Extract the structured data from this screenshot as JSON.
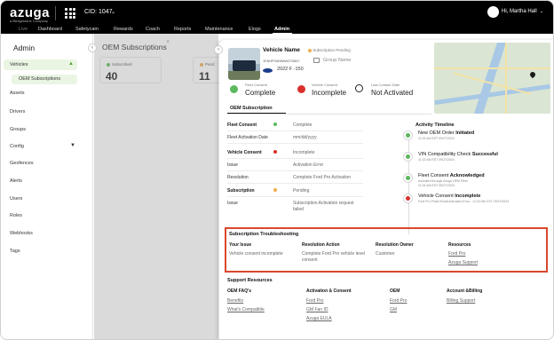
{
  "header": {
    "logo": "azuga",
    "logo_sub": "a Bridgestone Company",
    "cid": "CID: 1047",
    "user": "Hi, Martha Hall",
    "nav": [
      "Live",
      "Dashboard",
      "Safetycam",
      "Rewards",
      "Coach",
      "Reports",
      "Maintenance",
      "Elogs",
      "Admin"
    ],
    "active_nav": "Admin"
  },
  "sidebar": {
    "title": "Admin",
    "group": "Vehicles",
    "sub_item": "OEM Subscriptions",
    "items": [
      "Assets",
      "Drivers",
      "Groups",
      "Config",
      "Geofences",
      "Alerts",
      "Users",
      "Roles",
      "Webhooks",
      "Tags"
    ]
  },
  "page": {
    "title": "OEM Subscriptions",
    "count": "0",
    "stats": [
      {
        "label": "Subscribed",
        "value": "40",
        "color": "#5cb85c"
      },
      {
        "label": "Pend",
        "value": "11",
        "color": "#f0ad4e"
      }
    ]
  },
  "vehicle": {
    "name": "Vehicle Name",
    "subscription_status": "Subscription Pending",
    "vin": "1FAHP34N98W270847",
    "group": "Group Name",
    "year_model": "2022 F -150",
    "statuses": [
      {
        "label": "Fleet Consent",
        "value": "Complete",
        "color": "#5cb85c"
      },
      {
        "label": "Vehicle Consent",
        "value": "Incomplete",
        "color": "#d9302b"
      },
      {
        "label": "Last Contact Date",
        "value": "Not Activated",
        "color": "#222222"
      }
    ],
    "tab": "OEM Subscription"
  },
  "details": [
    {
      "key": "Fleet Consent",
      "value": "Complete",
      "bold": true,
      "dot": "#5cb85c"
    },
    {
      "key": "Fleet Activation Date",
      "value": "mm/dd/yyyy",
      "bold": false,
      "dot": ""
    },
    {
      "key": "Vehicle Consent",
      "value": "Incomplete",
      "bold": true,
      "dot": "#d9302b"
    },
    {
      "key": "Issue",
      "value": "Activation Error",
      "bold": false,
      "dot": ""
    },
    {
      "key": "Resolution",
      "value": "Complete Ford Pro Activation",
      "bold": false,
      "dot": ""
    },
    {
      "key": "Subscription",
      "value": "Pending",
      "bold": true,
      "dot": "#f0ad4e"
    },
    {
      "key": "Issue",
      "value": "Subscription Activation request failed",
      "bold": false,
      "dot": ""
    }
  ],
  "timeline": {
    "title": "Activity Timeline",
    "items": [
      {
        "title": "New OEM Order",
        "status": "Initiated",
        "meta": "11:02 AM EST 09/27/2024",
        "note": "",
        "color": "#5cb85c"
      },
      {
        "title": "VIN Compatibility Check",
        "status": "Successful",
        "meta": "11:02 AM EST 09/27/2024",
        "note": "",
        "color": "#5cb85c"
      },
      {
        "title": "Fleet Consent",
        "status": "Acknowledged",
        "meta": "11:02 AM EST 09/27/2024",
        "note": "Activated through Azuga OEM Fleet",
        "color": "#5cb85c"
      },
      {
        "title": "Vehicle Consent",
        "status": "Incomplete",
        "meta": "Ford Pro Portal Email Activation Error - 11:02 AM CST 09/27/2024",
        "note": "",
        "color": "#d9302b"
      }
    ]
  },
  "troubleshooting": {
    "title": "Subscription Troubleshooting",
    "headers": [
      "Your Issue",
      "Resolution Action",
      "Resolution Owner",
      "Resources"
    ],
    "issue": "Vehicle consent incomplete",
    "action": "Complete Ford Pro vehicle level consent",
    "owner": "Customer",
    "resources": [
      "Ford Pro",
      "Azuga Support"
    ]
  },
  "support": {
    "title": "Support Resources",
    "cols": [
      {
        "header": "OEM FAQ's",
        "links": [
          "Benefits",
          "What's Compatible"
        ]
      },
      {
        "header": "Activation & Consent",
        "links": [
          "Ford Pro",
          "GM Fan ID",
          "Azuga EULA"
        ]
      },
      {
        "header": "OEM",
        "links": [
          "Ford Pro",
          "GM"
        ]
      },
      {
        "header": "Account &Billing",
        "links": [
          "Billing Support"
        ]
      }
    ]
  }
}
